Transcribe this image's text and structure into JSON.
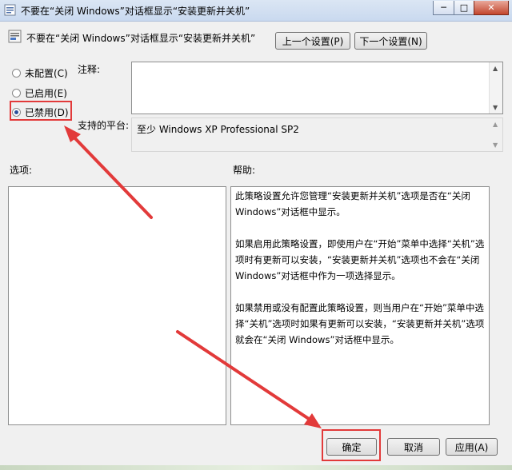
{
  "window": {
    "title": "不要在“关闭 Windows”对话框显示“安装更新并关机”",
    "min": "─",
    "max": "□",
    "close": "✕"
  },
  "header": {
    "policy_name": "不要在“关闭 Windows”对话框显示“安装更新并关机”",
    "prev_label": "上一个设置(P)",
    "next_label": "下一个设置(N)"
  },
  "state": {
    "options": [
      {
        "label": "未配置(C)",
        "selected": false
      },
      {
        "label": "已启用(E)",
        "selected": false
      },
      {
        "label": "已禁用(D)",
        "selected": true
      }
    ]
  },
  "comment": {
    "label": "注释:",
    "value": ""
  },
  "platform": {
    "label": "支持的平台:",
    "value": "至少 Windows XP Professional SP2"
  },
  "options_section": {
    "label": "选项:"
  },
  "help_section": {
    "label": "帮助:",
    "paragraphs": [
      "此策略设置允许您管理“安装更新并关机”选项是否在“关闭 Windows”对话框中显示。",
      "如果启用此策略设置，即使用户在“开始”菜单中选择“关机”选项时有更新可以安装，“安装更新并关机”选项也不会在“关闭 Windows”对话框中作为一项选择显示。",
      "如果禁用或没有配置此策略设置，则当用户在“开始”菜单中选择“关机”选项时如果有更新可以安装，“安装更新并关机”选项就会在“关闭 Windows”对话框中显示。"
    ]
  },
  "footer": {
    "ok_label": "确定",
    "cancel_label": "取消",
    "apply_label": "应用(A)"
  },
  "colors": {
    "annotation": "#e23a3a"
  }
}
